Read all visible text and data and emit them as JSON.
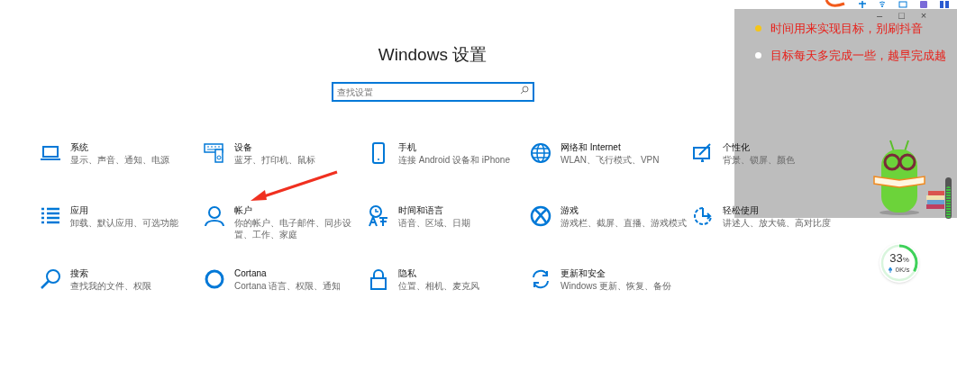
{
  "title": "Windows 设置",
  "search": {
    "placeholder": "查找设置"
  },
  "categories": [
    {
      "title": "系统",
      "subtitle": "显示、声音、通知、电源"
    },
    {
      "title": "设备",
      "subtitle": "蓝牙、打印机、鼠标"
    },
    {
      "title": "手机",
      "subtitle": "连接 Android 设备和 iPhone"
    },
    {
      "title": "网络和 Internet",
      "subtitle": "WLAN、飞行模式、VPN"
    },
    {
      "title": "个性化",
      "subtitle": "背景、锁屏、颜色"
    },
    {
      "title": "应用",
      "subtitle": "卸载、默认应用、可选功能"
    },
    {
      "title": "帐户",
      "subtitle": "你的帐户、电子邮件、同步设置、工作、家庭"
    },
    {
      "title": "时间和语言",
      "subtitle": "语音、区域、日期"
    },
    {
      "title": "游戏",
      "subtitle": "游戏栏、截屏、直播、游戏模式"
    },
    {
      "title": "轻松使用",
      "subtitle": "讲述人、放大镜、高对比度"
    },
    {
      "title": "搜索",
      "subtitle": "查找我的文件、权限"
    },
    {
      "title": "Cortana",
      "subtitle": "Cortana 语言、权限、通知"
    },
    {
      "title": "隐私",
      "subtitle": "位置、相机、麦克风"
    },
    {
      "title": "更新和安全",
      "subtitle": "Windows 更新、恢复、备份"
    }
  ],
  "overlay": {
    "window_controls": [
      "–",
      "□",
      "×"
    ],
    "notes": [
      {
        "text": "时间用来实现目标，别刷抖音",
        "color": "#f5c518"
      },
      {
        "text": "目标每天多完成一些，越早完成越",
        "color": "#ffffff"
      }
    ]
  },
  "usage_widget": {
    "reading": "33",
    "unit": "%",
    "speed": "0K/s",
    "level": 0.33
  }
}
